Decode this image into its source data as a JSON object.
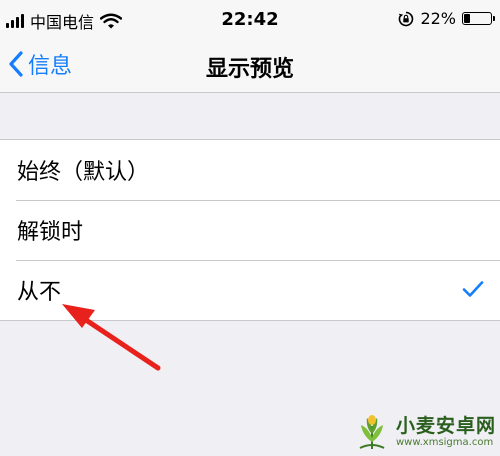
{
  "status_bar": {
    "carrier": "中国电信",
    "time": "22:42",
    "battery_percent": "22%",
    "battery_level": 0.22,
    "icons": [
      "signal-icon",
      "wifi-icon",
      "rotation-lock-icon",
      "battery-icon"
    ]
  },
  "nav": {
    "back_label": "信息",
    "title": "显示预览"
  },
  "options": [
    {
      "label": "始终（默认）",
      "selected": false
    },
    {
      "label": "解锁时",
      "selected": false
    },
    {
      "label": "从不",
      "selected": true
    }
  ],
  "colors": {
    "accent": "#147efb",
    "background": "#efeff4",
    "annotation_arrow": "#e8211c"
  },
  "watermark": {
    "title": "小麦安卓网",
    "url": "www.xmsigma.com"
  }
}
